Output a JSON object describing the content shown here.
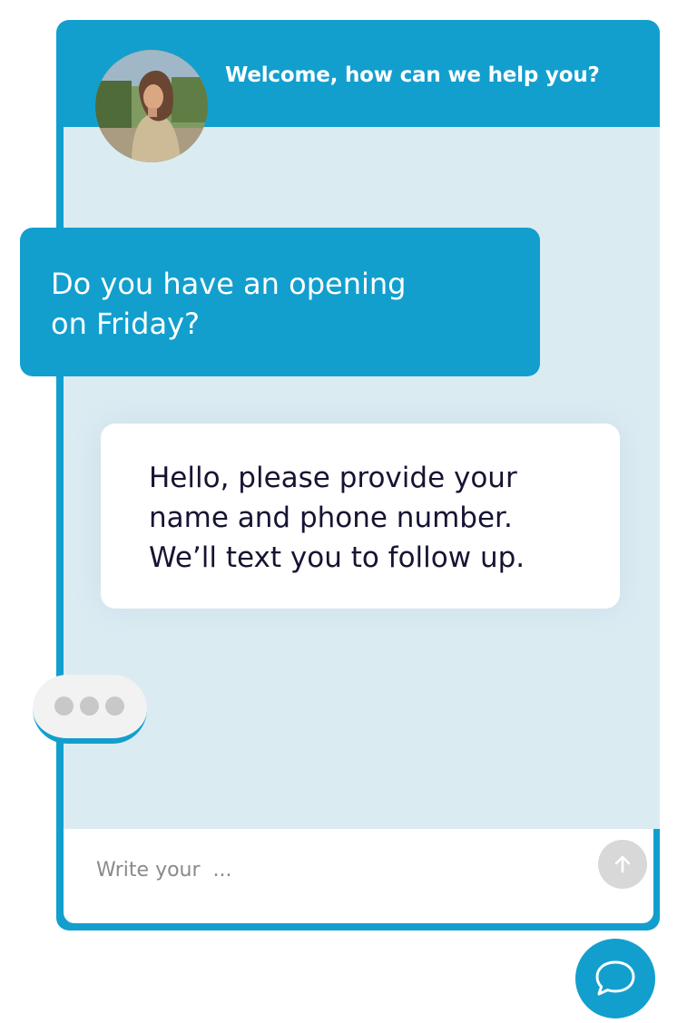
{
  "header": {
    "title": "Welcome, how can we help you?"
  },
  "messages": [
    {
      "sender": "user",
      "lines": [
        "Do you have an opening",
        "on Friday?"
      ]
    },
    {
      "sender": "agent",
      "lines": [
        "Hello, please provide your",
        "name and phone number.",
        "We’ll text you to follow up."
      ]
    }
  ],
  "composer": {
    "placeholder": "Write your  ...",
    "value": "",
    "send_icon": "arrow-up-icon"
  },
  "launcher": {
    "icon": "chat-bubble-icon"
  },
  "colors": {
    "brand": "#129fce",
    "chat_background": "#dbebf2",
    "agent_text": "#161432",
    "send_button": "#d8d8d8"
  }
}
